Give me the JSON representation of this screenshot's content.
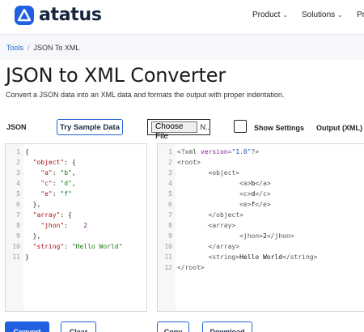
{
  "header": {
    "brand": "atatus",
    "nav": [
      {
        "label": "Product"
      },
      {
        "label": "Solutions"
      },
      {
        "label": "Pr"
      }
    ]
  },
  "breadcrumb": {
    "root": "Tools",
    "separator": "/",
    "current": "JSON To XML"
  },
  "page": {
    "title": "JSON to XML Converter",
    "description": "Convert a JSON data into an XML data and formats the output with proper indentation."
  },
  "controls": {
    "json_label": "JSON",
    "sample_button": "Try Sample Data",
    "file_button": "Choose File",
    "file_name": "N..",
    "show_settings": "Show Settings",
    "show_settings_checked": false,
    "output_label": "Output (XML)"
  },
  "json_input": {
    "lines": [
      {
        "num": "1",
        "text": "{"
      },
      {
        "num": "2",
        "text": "  \"object\": {"
      },
      {
        "num": "3",
        "text": "    \"a\": \"b\","
      },
      {
        "num": "4",
        "text": "    \"c\": \"d\","
      },
      {
        "num": "5",
        "text": "    \"e\": \"f\""
      },
      {
        "num": "6",
        "text": "  },"
      },
      {
        "num": "7",
        "text": "  \"array\": {"
      },
      {
        "num": "8",
        "text": "    \"jhon\":    2"
      },
      {
        "num": "9",
        "text": "  },"
      },
      {
        "num": "10",
        "text": "  \"string\": \"Hello World\""
      },
      {
        "num": "11",
        "text": "}"
      }
    ]
  },
  "xml_output": {
    "lines": [
      {
        "num": "1",
        "text": "<?xml version=\"1.0\"?>"
      },
      {
        "num": "2",
        "text": "<root>"
      },
      {
        "num": "3",
        "text": "        <object>"
      },
      {
        "num": "4",
        "text": "                <a>b</a>"
      },
      {
        "num": "5",
        "text": "                <c>d</c>"
      },
      {
        "num": "6",
        "text": "                <e>f</e>"
      },
      {
        "num": "7",
        "text": "        </object>"
      },
      {
        "num": "8",
        "text": "        <array>"
      },
      {
        "num": "9",
        "text": "                <jhon>2</jhon>"
      },
      {
        "num": "10",
        "text": "        </array>"
      },
      {
        "num": "11",
        "text": "        <string>Hello World</string>"
      },
      {
        "num": "12",
        "text": "</root>"
      }
    ]
  },
  "actions": {
    "convert": "Convert",
    "clear": "Clear",
    "copy": "Copy",
    "download": "Download"
  },
  "colors": {
    "brand": "#1f5fe0",
    "json_key": "#a11111",
    "json_string": "#1a7a1a",
    "json_number": "#7a1e9a"
  }
}
